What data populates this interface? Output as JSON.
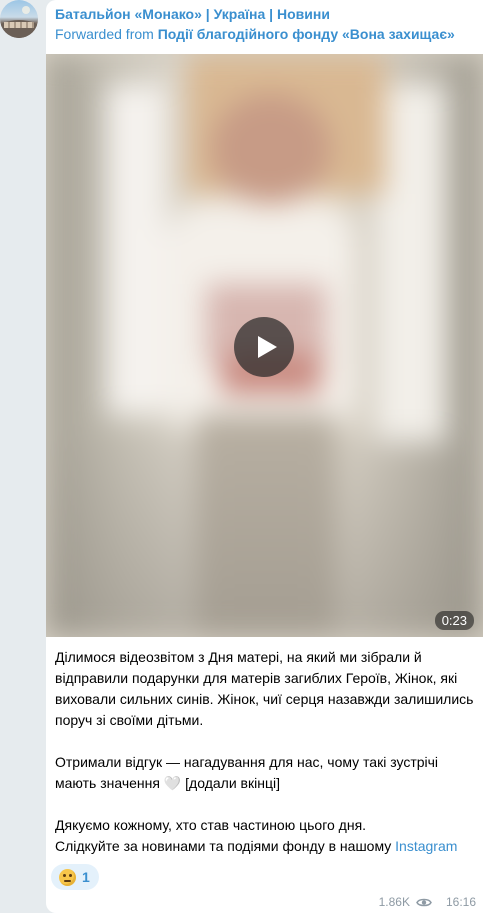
{
  "message": {
    "channel_name": "Батальйон «Монако» | Україна | Новини",
    "forwarded_prefix": "Forwarded from ",
    "forwarded_source": "Події благодійного фонду «Вона захищає»",
    "video": {
      "duration": "0:23",
      "play_icon": "play-icon"
    },
    "text": {
      "p1": "Ділимося відеозвітом з Дня матері, на який ми зібрали й відправили подарунки для матерів загиблих Героїв, Жінок, які виховали сильних синів. Жінок, чиї серця назавжди залишились поруч зі своїми дітьми.",
      "p2": "Отримали відгук — нагадування для нас, чому такі зустрічі мають значення 🤍 [додали вкінці]",
      "p3_line1": "Дякуємо кожному, хто став частиною цього дня.",
      "p3_line2": "Слідкуйте за новинами та подіями фонду в нашому ",
      "link": "Instagram"
    },
    "reaction": {
      "emoji": "thinking-face",
      "count": "1"
    },
    "views": "1.86K",
    "time": "16:16"
  },
  "colors": {
    "accent": "#3a8fcf",
    "bubble": "#ffffff",
    "background": "#e6ebee",
    "meta": "#8e9aa4"
  }
}
